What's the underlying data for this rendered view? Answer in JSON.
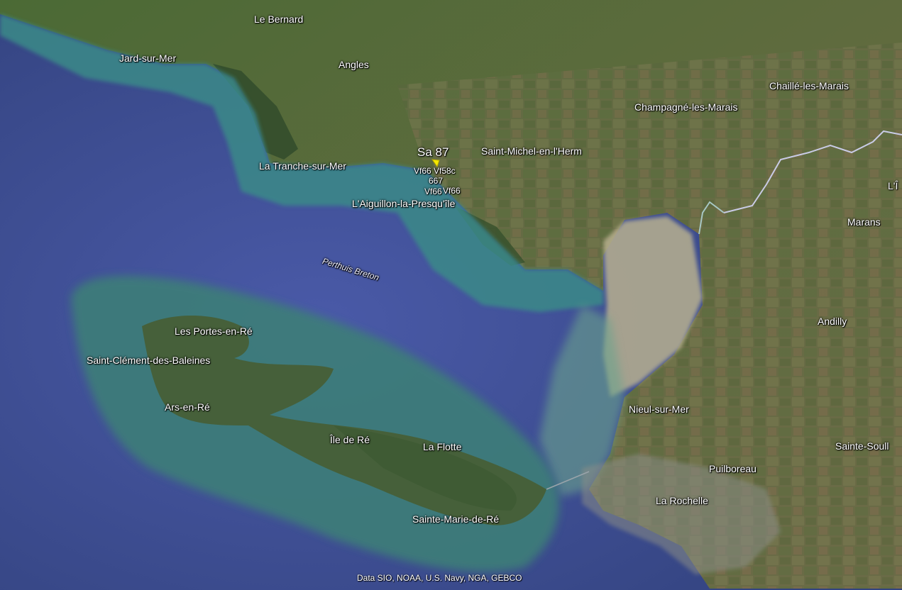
{
  "map": {
    "places": [
      {
        "id": "le-bernard",
        "label": "Le Bernard"
      },
      {
        "id": "jard-sur-mer",
        "label": "Jard-sur-Mer"
      },
      {
        "id": "angles",
        "label": "Angles"
      },
      {
        "id": "chaille-les-marais",
        "label": "Chaillé-les-Marais"
      },
      {
        "id": "champagne-les-marais",
        "label": "Champagné-les-Marais"
      },
      {
        "id": "saint-michel-en-lherm",
        "label": "Saint-Michel-en-l'Herm"
      },
      {
        "id": "la-tranche-sur-mer",
        "label": "La Tranche-sur-Mer"
      },
      {
        "id": "laiguillon-la-presquile",
        "label": "L'Aiguillon-la-Presqu'île"
      },
      {
        "id": "marans",
        "label": "Marans"
      },
      {
        "id": "li-partial",
        "label": "L'Î"
      },
      {
        "id": "andilly",
        "label": "Andilly"
      },
      {
        "id": "les-portes-en-re",
        "label": "Les Portes-en-Ré"
      },
      {
        "id": "saint-clement-des-baleines",
        "label": "Saint-Clément-des-Baleines"
      },
      {
        "id": "ars-en-re",
        "label": "Ars-en-Ré"
      },
      {
        "id": "ile-de-re",
        "label": "Île de Ré"
      },
      {
        "id": "la-flotte",
        "label": "La Flotte"
      },
      {
        "id": "nieul-sur-mer",
        "label": "Nieul-sur-Mer"
      },
      {
        "id": "sainte-soulle-partial",
        "label": "Sainte-Soull"
      },
      {
        "id": "puilboreau",
        "label": "Puilboreau"
      },
      {
        "id": "la-rochelle",
        "label": "La Rochelle"
      },
      {
        "id": "sainte-marie-de-re",
        "label": "Sainte-Marie-de-Ré"
      }
    ],
    "water_label": "Perthuis Breton",
    "marker": {
      "title": "Sa 87",
      "sublabels": [
        "Vf66",
        "Vf58c",
        "667",
        "Vf66",
        "Vf66"
      ],
      "color": "#f5e900"
    },
    "attribution": "Data SIO, NOAA, U.S. Navy, NGA, GEBCO",
    "colors": {
      "sea": "#3d4f96",
      "shallow": "#3f8f86",
      "land": "#4f6b3a",
      "mudflat": "#b9b295"
    }
  }
}
